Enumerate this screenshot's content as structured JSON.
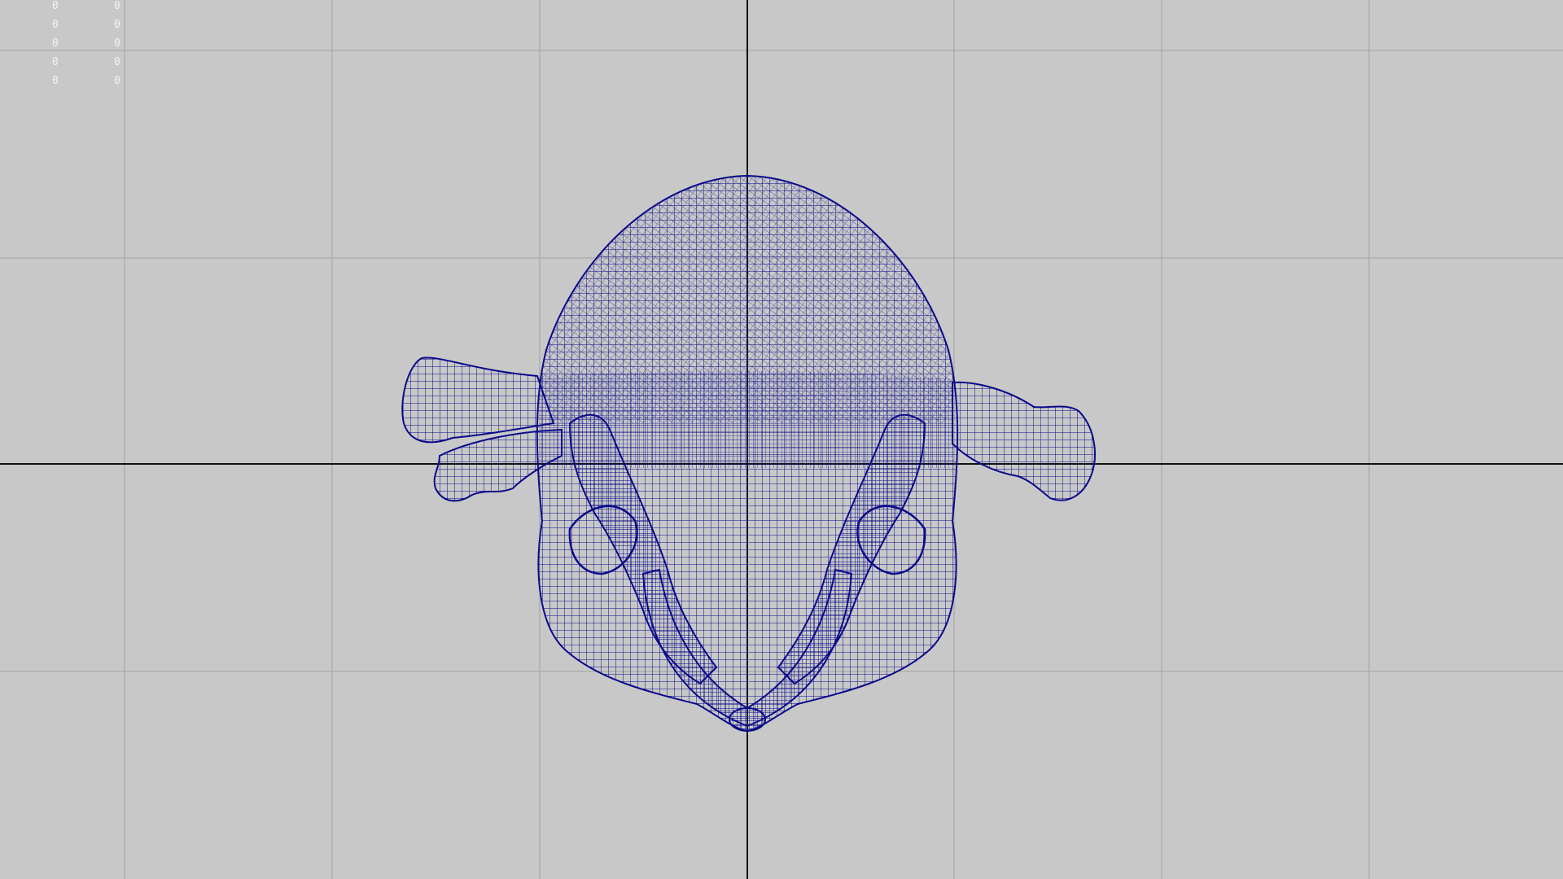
{
  "viewport": {
    "view": "front",
    "background_color": "#c8c8c8",
    "grid_color": "#a8a8a8",
    "axis_color": "#111111",
    "wire_color": "#0a0a8a"
  },
  "hud": {
    "columns": [
      [
        "0",
        "0",
        "0",
        "0",
        "0"
      ],
      [
        "0",
        "0",
        "0",
        "0",
        "0"
      ]
    ]
  },
  "model": {
    "type": "skull-with-bones",
    "render_mode": "wireframe"
  }
}
